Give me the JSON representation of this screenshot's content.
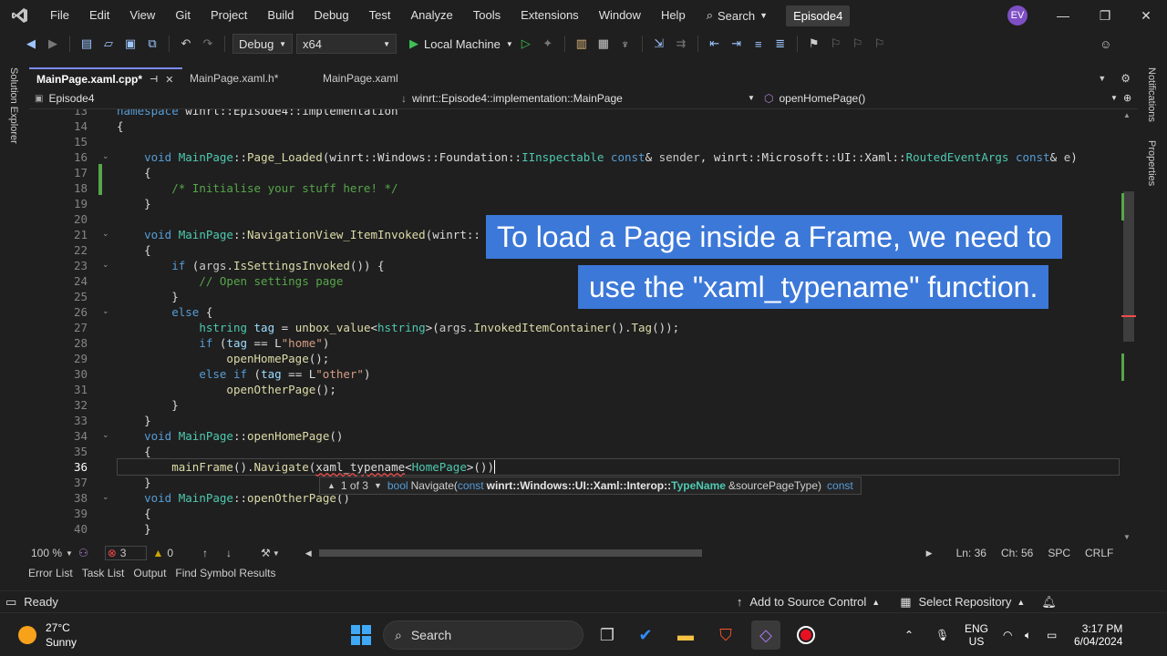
{
  "menu": {
    "items": [
      "File",
      "Edit",
      "View",
      "Git",
      "Project",
      "Build",
      "Debug",
      "Test",
      "Analyze",
      "Tools",
      "Extensions",
      "Window",
      "Help"
    ],
    "search_label": "Search",
    "solution_name": "Episode4",
    "user_initials": "EV"
  },
  "toolbar": {
    "configuration": "Debug",
    "platform": "x64",
    "run_label": "Local Machine"
  },
  "side_panels": {
    "left": "Solution Explorer",
    "right_top": "Notifications",
    "right_bottom": "Properties"
  },
  "tabs": [
    {
      "label": "MainPage.xaml.cpp*",
      "active": true
    },
    {
      "label": "MainPage.xaml.h*",
      "active": false
    },
    {
      "label": "MainPage.xaml",
      "active": false
    }
  ],
  "navbar": {
    "project": "Episode4",
    "scope": "winrt::Episode4::implementation::MainPage",
    "member": "openHomePage()"
  },
  "editor": {
    "current_line": "36",
    "lines": [
      {
        "n": "13",
        "text": "namespace winrt::Episode4::implementation"
      },
      {
        "n": "14",
        "text": "{"
      },
      {
        "n": "15",
        "text": ""
      },
      {
        "n": "16",
        "text": "    void MainPage::Page_Loaded(winrt::Windows::Foundation::IInspectable const& sender, winrt::Microsoft::UI::Xaml::RoutedEventArgs const& e)"
      },
      {
        "n": "17",
        "text": "    {"
      },
      {
        "n": "18",
        "text": "        /* Initialise your stuff here! */"
      },
      {
        "n": "19",
        "text": "    }"
      },
      {
        "n": "20",
        "text": ""
      },
      {
        "n": "21",
        "text": "    void MainPage::NavigationView_ItemInvoked(winrt::"
      },
      {
        "n": "22",
        "text": "    {"
      },
      {
        "n": "23",
        "text": "        if (args.IsSettingsInvoked()) {"
      },
      {
        "n": "24",
        "text": "            // Open settings page"
      },
      {
        "n": "25",
        "text": "        }"
      },
      {
        "n": "26",
        "text": "        else {"
      },
      {
        "n": "27",
        "text": "            hstring tag = unbox_value<hstring>(args.InvokedItemContainer().Tag());"
      },
      {
        "n": "28",
        "text": "            if (tag == L\"home\")"
      },
      {
        "n": "29",
        "text": "                openHomePage();"
      },
      {
        "n": "30",
        "text": "            else if (tag == L\"other\")"
      },
      {
        "n": "31",
        "text": "                openOtherPage();"
      },
      {
        "n": "32",
        "text": "        }"
      },
      {
        "n": "33",
        "text": "    }"
      },
      {
        "n": "34",
        "text": "    void MainPage::openHomePage()"
      },
      {
        "n": "35",
        "text": "    {"
      },
      {
        "n": "36",
        "text": "        mainFrame().Navigate(xaml_typename<HomePage>())"
      },
      {
        "n": "37",
        "text": "    }"
      },
      {
        "n": "38",
        "text": "    void MainPage::openOtherPage()"
      },
      {
        "n": "39",
        "text": "    {"
      },
      {
        "n": "40",
        "text": "    }"
      }
    ]
  },
  "signature_help": {
    "counter": "1 of 3",
    "return_type": "bool",
    "method": "Navigate(",
    "param_const": "const",
    "param_ns": "winrt::Windows::UI::Xaml::Interop::",
    "param_type": "TypeName",
    "param_name": "&sourcePageType)",
    "trailing": "const"
  },
  "caption": {
    "line1": "To load a Page inside a Frame, we need to",
    "line2": "use the \"xaml_typename\" function."
  },
  "editor_status": {
    "zoom": "100 %",
    "errors": "3",
    "warnings": "0",
    "line": "Ln: 36",
    "col": "Ch: 56",
    "whitespace": "SPC",
    "eol": "CRLF"
  },
  "panel_tabs": [
    "Error List",
    "Task List",
    "Output",
    "Find Symbol Results"
  ],
  "statusbar": {
    "state": "Ready",
    "source_control": "Add to Source Control",
    "repository": "Select Repository"
  },
  "taskbar": {
    "temperature": "27°C",
    "condition": "Sunny",
    "search_label": "Search",
    "lang1": "ENG",
    "lang2": "US",
    "time": "3:17 PM",
    "date": "6/04/2024"
  }
}
